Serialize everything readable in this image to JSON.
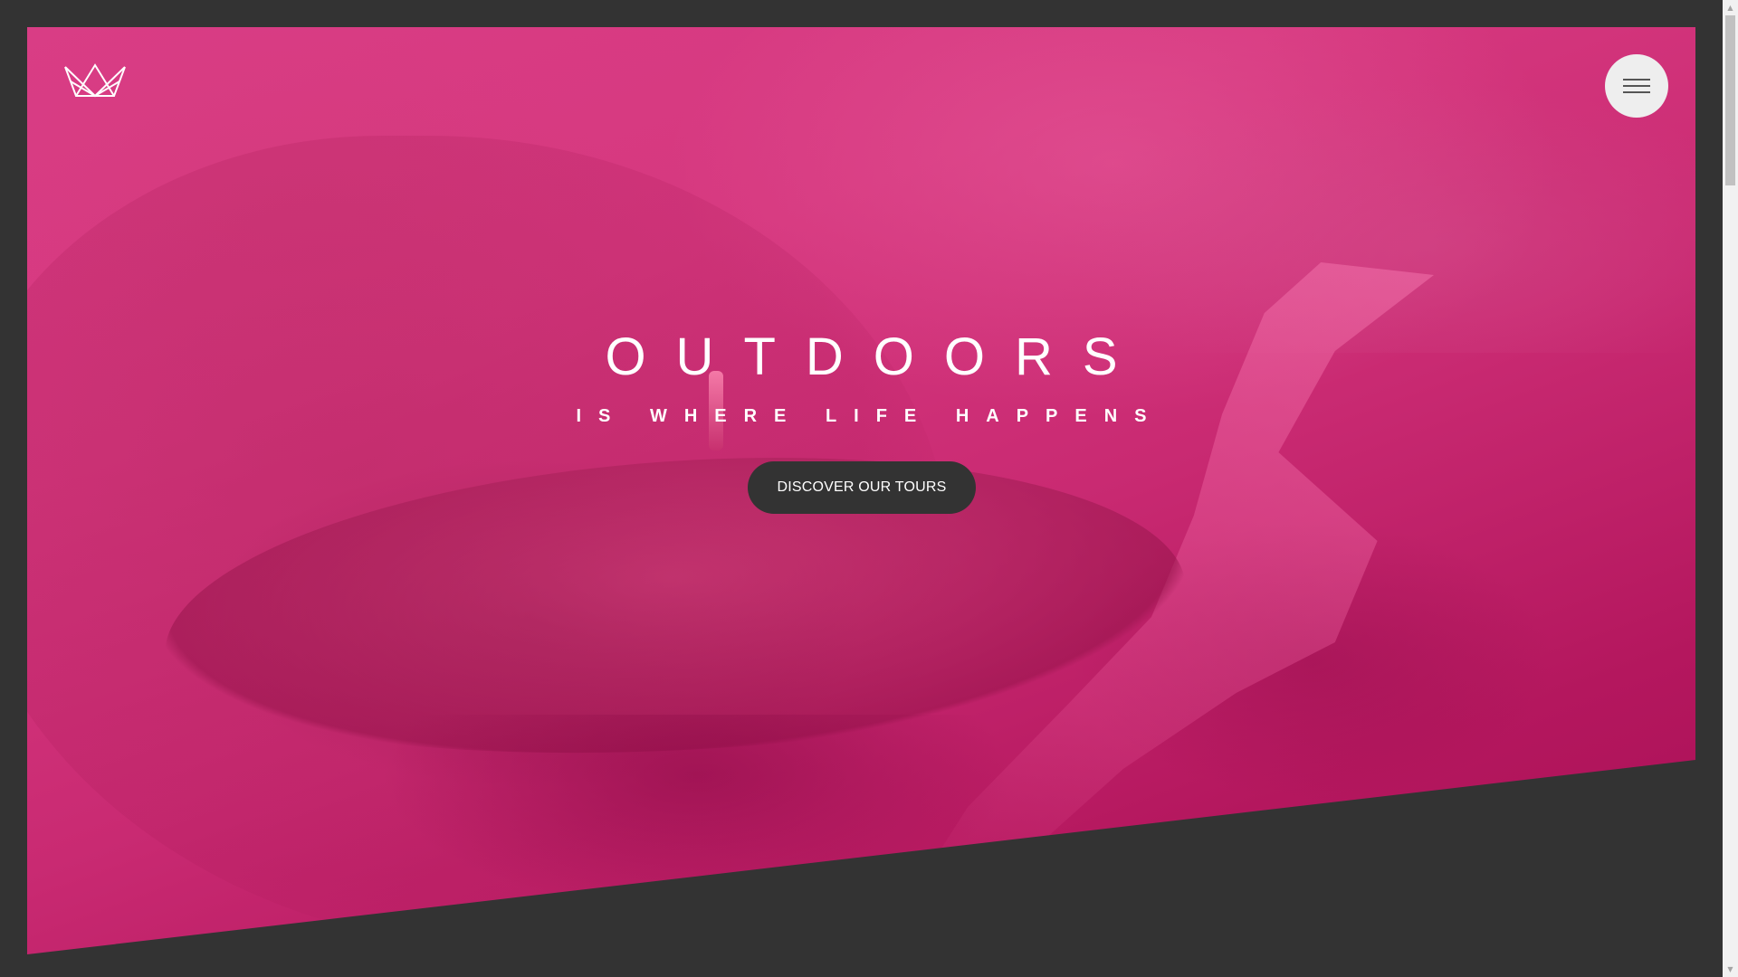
{
  "hero": {
    "headline": "OUTDOORS",
    "subheadline": "IS WHERE LIFE HAPPENS",
    "cta_label": "DISCOVER OUR TOURS"
  },
  "header": {
    "logo_icon": "crown-icon",
    "menu_icon": "hamburger-menu-icon"
  },
  "colors": {
    "hero_pink": "#d6387f",
    "dark_background": "#333333",
    "menu_button_bg": "#eeeeee",
    "text_white": "#ffffff"
  },
  "scrollbar": {
    "up_icon": "scroll-up-arrow-icon",
    "down_icon": "scroll-down-arrow-icon"
  }
}
